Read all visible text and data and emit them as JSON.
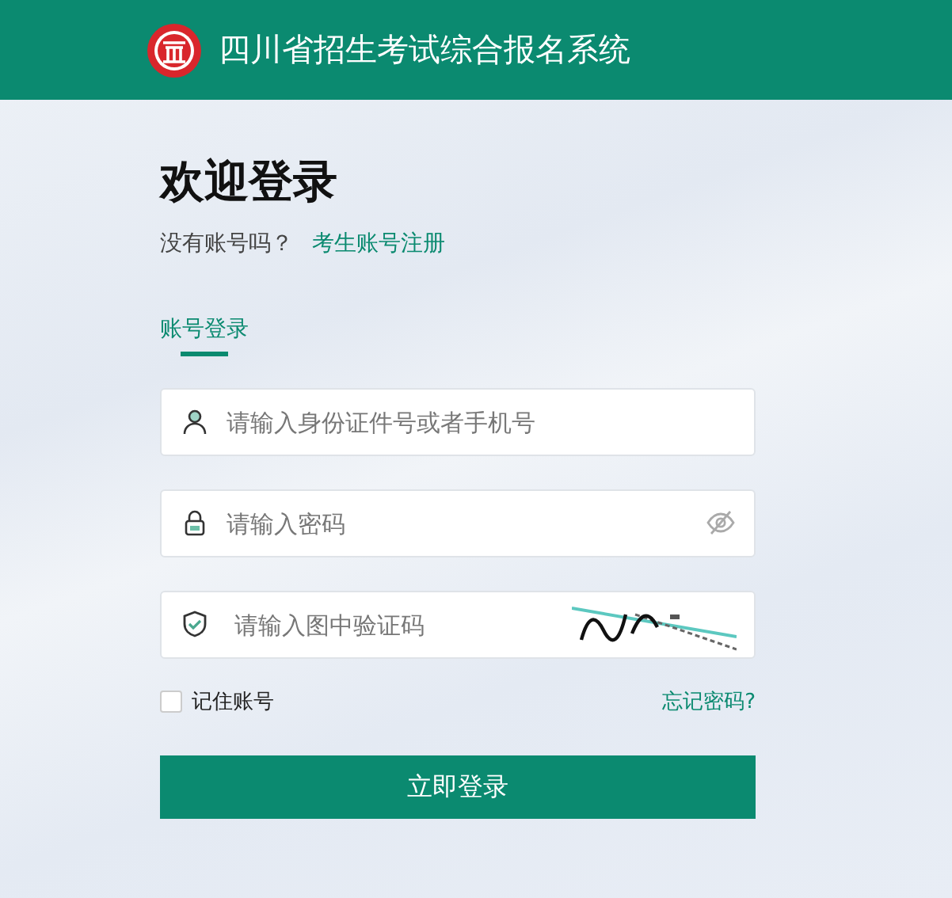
{
  "header": {
    "title": "四川省招生考试综合报名系统"
  },
  "login": {
    "heading": "欢迎登录",
    "no_account": "没有账号吗？",
    "register_link": "考生账号注册",
    "tabs": [
      {
        "label": "账号登录",
        "selected": true
      }
    ],
    "fields": [
      {
        "kind": "account",
        "placeholder": "请输入身份证件号或者手机号"
      },
      {
        "kind": "password",
        "placeholder": "请输入密码"
      },
      {
        "kind": "captcha",
        "placeholder": "请输入图中验证码"
      }
    ],
    "remember": {
      "label": "记住账号",
      "checked": false
    },
    "forgot_link": "忘记密码?",
    "submit": "立即登录"
  }
}
